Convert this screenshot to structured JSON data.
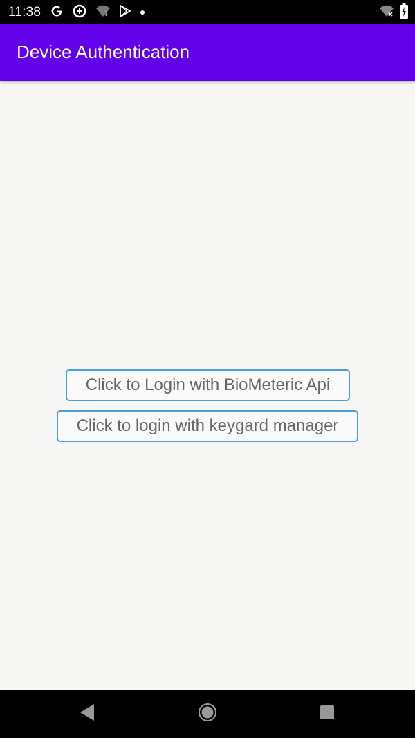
{
  "status_bar": {
    "time": "11:38",
    "left_icons": [
      "google-icon",
      "data-saver-icon",
      "wifi-question-icon",
      "play-store-icon",
      "notification-dot-icon"
    ],
    "right_icons": [
      "wifi-off-icon",
      "battery-charging-icon"
    ]
  },
  "app_bar": {
    "title": "Device Authentication",
    "color": "#6200ea"
  },
  "main": {
    "biometric_button_label": "Click to Login with BioMeteric Api",
    "keyguard_button_label": "Click to login with keygard manager",
    "button_border_color": "#4a9fe0"
  },
  "nav_bar": {
    "icons": [
      "back-icon",
      "home-icon",
      "recents-icon"
    ]
  }
}
